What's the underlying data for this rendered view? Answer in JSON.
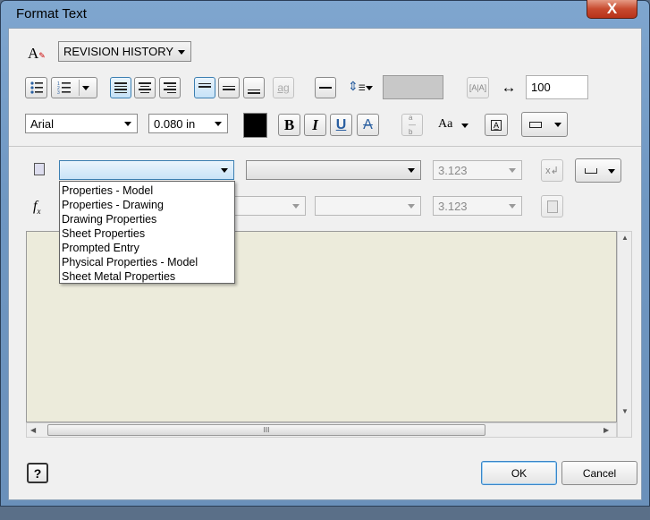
{
  "window": {
    "title": "Format Text",
    "close_glyph": "X"
  },
  "row1": {
    "style_value": "REVISION HISTORY"
  },
  "row2": {
    "stretch_value": "100",
    "ag_label": "ag"
  },
  "row3": {
    "font_value": "Arial",
    "size_value": "0.080 in",
    "color_swatch": "#000000",
    "bold_label": "B",
    "italic_label": "I",
    "underline_label": "U",
    "strike_label": "A"
  },
  "row4": {
    "type_value": "",
    "property_value": "",
    "precision_value": "3.123"
  },
  "row5": {
    "precision_value": "3.123"
  },
  "dropdown": {
    "options": [
      "Properties - Model",
      "Properties - Drawing",
      "Drawing Properties",
      "Sheet Properties",
      "Prompted Entry",
      "Physical Properties - Model",
      "Sheet Metal Properties"
    ]
  },
  "footer": {
    "ok_label": "OK",
    "cancel_label": "Cancel",
    "help_label": "?"
  },
  "scrollbar": {
    "grip_label": "III"
  },
  "colors": {
    "editor_bg": "#ecebdb",
    "accent": "#3c7fb1"
  }
}
